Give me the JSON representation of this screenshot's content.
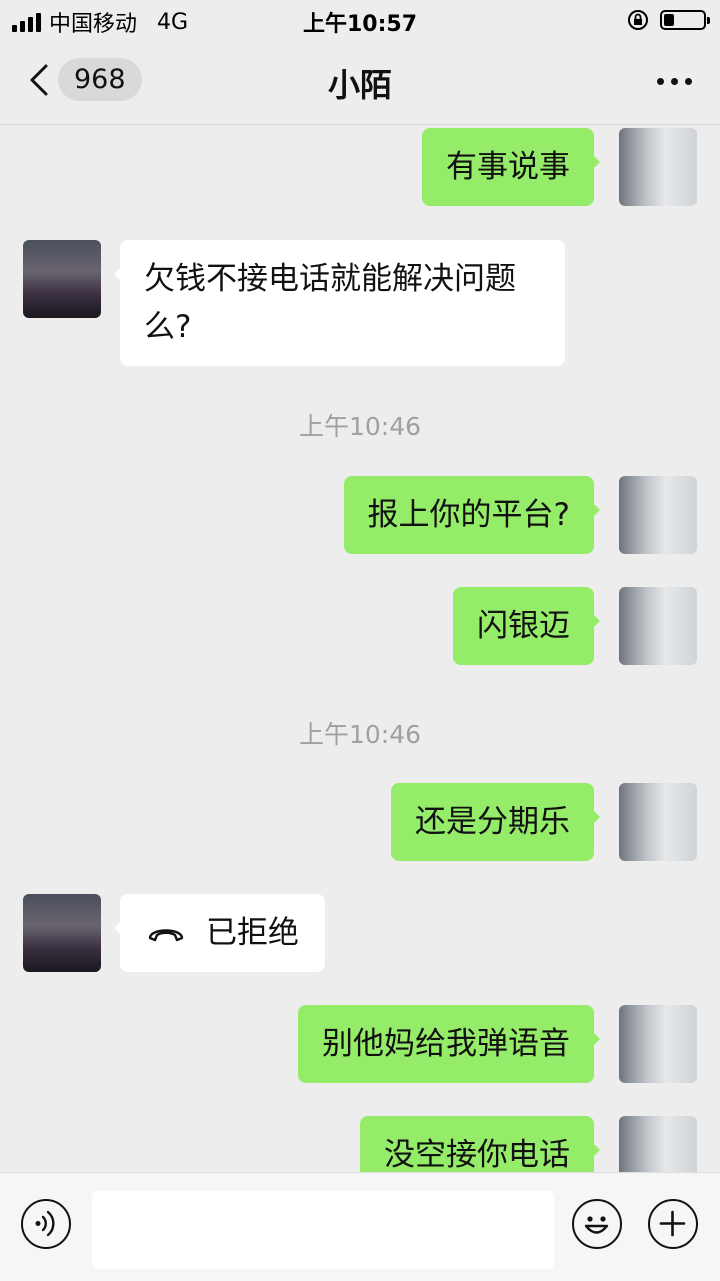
{
  "status_bar": {
    "carrier": "中国移动",
    "network": "4G",
    "time": "上午10:57",
    "battery_level": 0.25
  },
  "nav": {
    "back_icon": "chevron-left-icon",
    "unread_count": "968",
    "title": "小陌",
    "more_icon": "more-dots-icon"
  },
  "messages": [
    {
      "from": "me",
      "text": "有事说事"
    },
    {
      "from": "other",
      "text": "欠钱不接电话就能解决问题么?"
    },
    {
      "type": "time",
      "text": "上午10:46"
    },
    {
      "from": "me",
      "text": "报上你的平台?"
    },
    {
      "from": "me",
      "text": "闪银迈"
    },
    {
      "type": "time",
      "text": "上午10:46"
    },
    {
      "from": "me",
      "text": "还是分期乐"
    },
    {
      "from": "other",
      "call_icon": "phone-hangup-icon",
      "text": "已拒绝"
    },
    {
      "from": "me",
      "text": "别他妈给我弹语音"
    },
    {
      "from": "me",
      "text": "没空接你电话"
    }
  ],
  "input_bar": {
    "voice_icon": "voice-icon",
    "text_value": "",
    "emoji_icon": "emoji-icon",
    "plus_icon": "plus-icon"
  }
}
